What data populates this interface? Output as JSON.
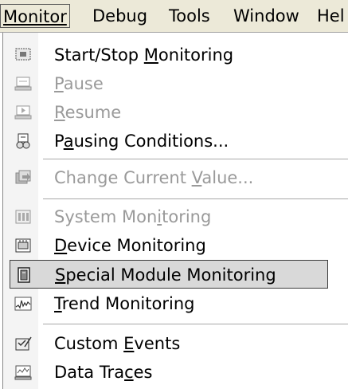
{
  "menubar": {
    "monitor": "Monitor",
    "debug": "Debug",
    "tools": "Tools",
    "window": "Window",
    "help": "Hel"
  },
  "menu": {
    "start_stop": [
      "Start/Stop ",
      "M",
      "onitoring"
    ],
    "pause": [
      "",
      "P",
      "ause"
    ],
    "resume": [
      "",
      "R",
      "esume"
    ],
    "pausing_conditions": [
      "P",
      "a",
      "using Conditions..."
    ],
    "change_value": [
      "Change Current ",
      "V",
      "alue..."
    ],
    "system_monitoring": [
      "System Mon",
      "i",
      "toring"
    ],
    "device_monitoring": [
      "",
      "D",
      "evice Monitoring"
    ],
    "special_module": [
      "",
      "S",
      "pecial Module Monitoring"
    ],
    "trend_monitoring": [
      "",
      "T",
      "rend Monitoring"
    ],
    "custom_events": [
      "Custom ",
      "E",
      "vents"
    ],
    "data_traces": [
      "Data Tra",
      "c",
      "es"
    ]
  },
  "icons": {
    "start_stop": "monitor-icon",
    "pause": "pause-icon",
    "resume": "resume-icon",
    "pausing_conditions": "conditions-icon",
    "change_value": "change-value-icon",
    "system_monitoring": "system-icon",
    "device_monitoring": "device-icon",
    "special_module": "module-icon",
    "trend_monitoring": "trend-icon",
    "custom_events": "events-icon",
    "data_traces": "traces-icon"
  },
  "colors": {
    "menubar_bg": "#ece9d8",
    "disabled_text": "#9a9a9a",
    "highlight_bg": "#d9d9d9"
  }
}
